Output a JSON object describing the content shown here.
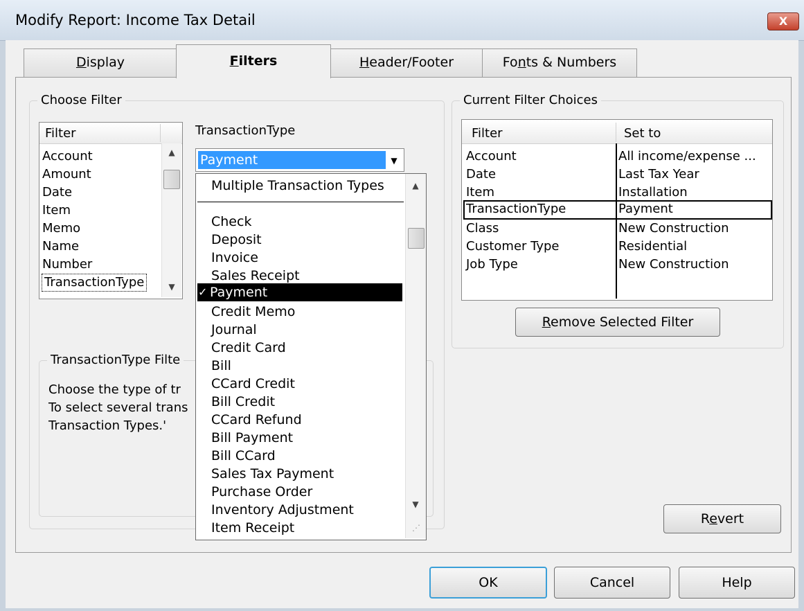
{
  "window": {
    "title": "Modify Report: Income Tax Detail",
    "close_glyph": "X"
  },
  "tabs": [
    {
      "pre": "",
      "u": "D",
      "post": "isplay"
    },
    {
      "pre": "",
      "u": "F",
      "post": "ilters"
    },
    {
      "pre": "",
      "u": "H",
      "post": "eader/Footer"
    },
    {
      "pre": "Fo",
      "u": "n",
      "post": "ts & Numbers"
    }
  ],
  "choose_filter": {
    "legend": "Choose Filter",
    "list_header": "Filter",
    "items": [
      "Account",
      "Amount",
      "Date",
      "Item",
      "Memo",
      "Name",
      "Number",
      "TransactionType"
    ],
    "selected": "TransactionType"
  },
  "transaction_type": {
    "label": "TransactionType",
    "selected_value": "Payment",
    "dropdown": {
      "top_item": "Multiple Transaction Types",
      "check_glyph": "✓",
      "items": [
        "Check",
        "Deposit",
        "Invoice",
        "Sales Receipt",
        "Payment",
        "Credit Memo",
        "Journal",
        "Credit Card",
        "Bill",
        "CCard Credit",
        "Bill Credit",
        "CCard Refund",
        "Bill Payment",
        "Bill CCard",
        "Sales Tax Payment",
        "Purchase Order",
        "Inventory Adjustment",
        "Item Receipt"
      ],
      "checked": "Payment"
    }
  },
  "filter_help": {
    "legend": "TransactionType Filte",
    "lines": [
      "Choose the type of tr",
      "To select several trans",
      "Transaction Types.'"
    ]
  },
  "current_filters": {
    "legend": "Current Filter Choices",
    "col_filter": "Filter",
    "col_set_to": "Set to",
    "rows": [
      {
        "filter": "Account",
        "set_to": "All income/expense ..."
      },
      {
        "filter": "Date",
        "set_to": "Last Tax Year"
      },
      {
        "filter": "Item",
        "set_to": "Installation"
      },
      {
        "filter": "TransactionType",
        "set_to": "Payment"
      },
      {
        "filter": "Class",
        "set_to": "New Construction"
      },
      {
        "filter": "Customer Type",
        "set_to": "Residential"
      },
      {
        "filter": "Job Type",
        "set_to": "New Construction"
      }
    ],
    "selected_row": "TransactionType"
  },
  "buttons": {
    "remove": {
      "u": "R",
      "post": "emove Selected Filter"
    },
    "revert": {
      "pre": "R",
      "u": "e",
      "post": "vert"
    },
    "ok": "OK",
    "cancel": "Cancel",
    "help": "Help"
  },
  "colors": {
    "selection_blue": "#3399ff",
    "check_highlight": "#000000",
    "default_button_border": "#3b9fd8"
  }
}
